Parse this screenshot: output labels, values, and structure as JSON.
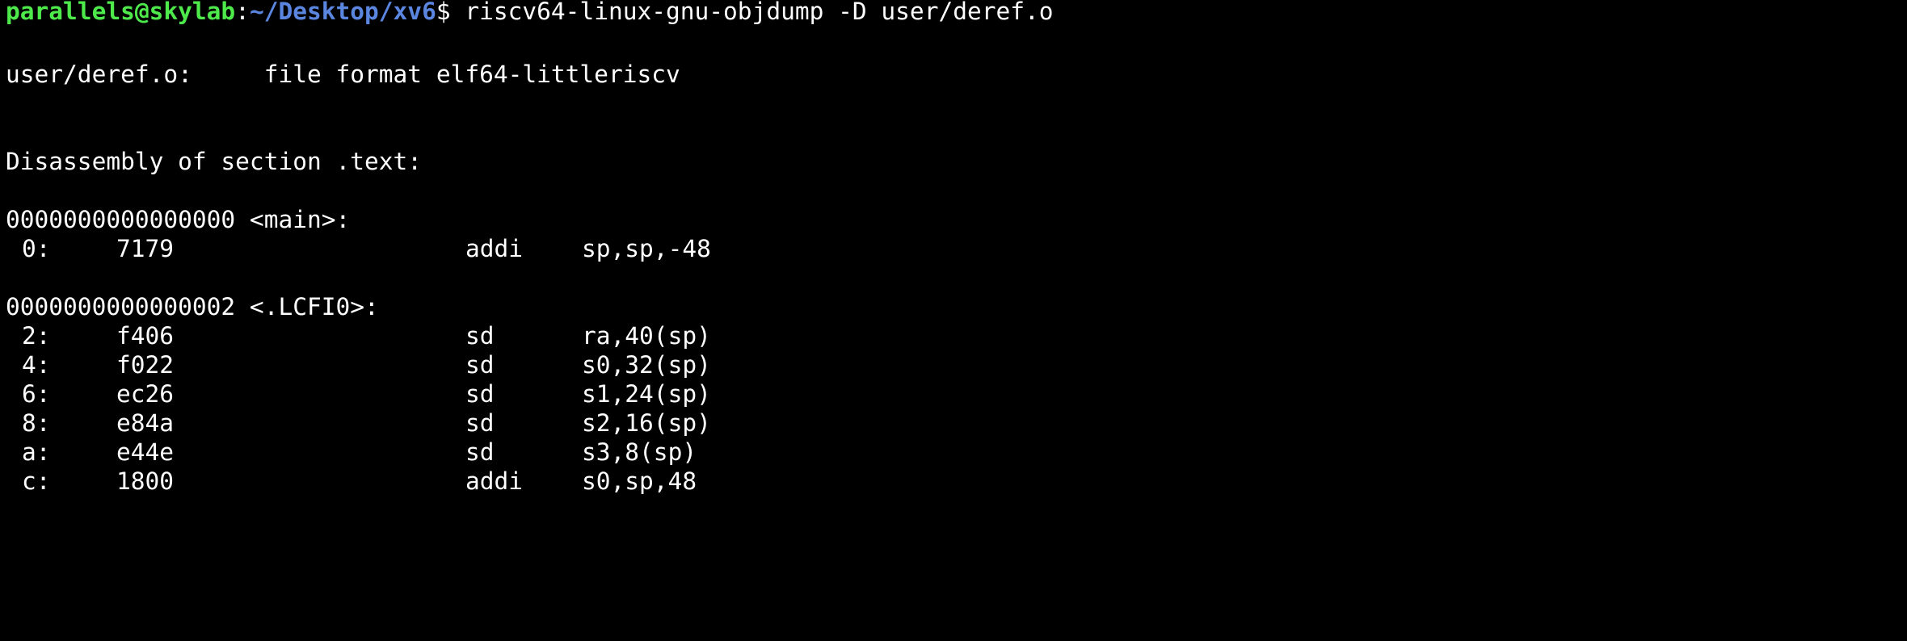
{
  "prompt": {
    "user_host": "parallels@skylab",
    "colon": ":",
    "cwd": "~/Desktop/xv6",
    "symbol": "$",
    "command": " riscv64-linux-gnu-objdump -D user/deref.o"
  },
  "file_header": "user/deref.o:     file format elf64-littleriscv",
  "section_header": "Disassembly of section .text:",
  "blocks": [
    {
      "label": "0000000000000000 <main>:",
      "rows": [
        {
          "addr": "0:",
          "hex": "7179",
          "mnemonic": "addi",
          "operands": "sp,sp,-48"
        }
      ]
    },
    {
      "label": "0000000000000002 <.LCFI0>:",
      "rows": [
        {
          "addr": "2:",
          "hex": "f406",
          "mnemonic": "sd",
          "operands": "ra,40(sp)"
        },
        {
          "addr": "4:",
          "hex": "f022",
          "mnemonic": "sd",
          "operands": "s0,32(sp)"
        },
        {
          "addr": "6:",
          "hex": "ec26",
          "mnemonic": "sd",
          "operands": "s1,24(sp)"
        },
        {
          "addr": "8:",
          "hex": "e84a",
          "mnemonic": "sd",
          "operands": "s2,16(sp)"
        },
        {
          "addr": "a:",
          "hex": "e44e",
          "mnemonic": "sd",
          "operands": "s3,8(sp)"
        },
        {
          "addr": "c:",
          "hex": "1800",
          "mnemonic": "addi",
          "operands": "s0,sp,48"
        }
      ]
    }
  ],
  "colors": {
    "background": "#000000",
    "text": "#ffffff",
    "user_host": "#4ee94b",
    "path": "#5b86e0"
  }
}
